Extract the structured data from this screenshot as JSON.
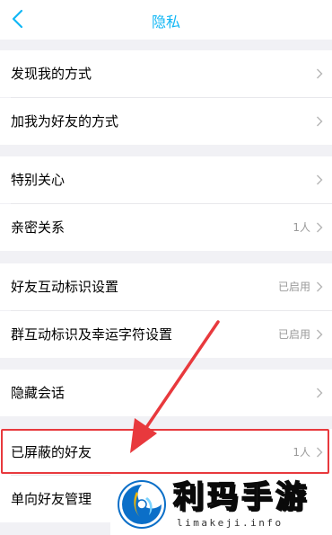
{
  "nav": {
    "title": "隐私"
  },
  "rows": [
    {
      "label": "发现我的方式",
      "value": ""
    },
    {
      "label": "加我为好友的方式",
      "value": ""
    },
    {
      "label": "特别关心",
      "value": ""
    },
    {
      "label": "亲密关系",
      "value": "1人"
    },
    {
      "label": "好友互动标识设置",
      "value": "已启用"
    },
    {
      "label": "群互动标识及幸运字符设置",
      "value": "已启用"
    },
    {
      "label": "隐藏会话",
      "value": ""
    },
    {
      "label": "已屏蔽的好友",
      "value": "1人"
    },
    {
      "label": "单向好友管理",
      "value": ""
    }
  ],
  "watermark": {
    "title": "利玛手游",
    "url": "limakeji.info"
  },
  "colors": {
    "accent": "#12b7f5",
    "highlight": "#e8393d",
    "background": "#f1f1f5"
  }
}
